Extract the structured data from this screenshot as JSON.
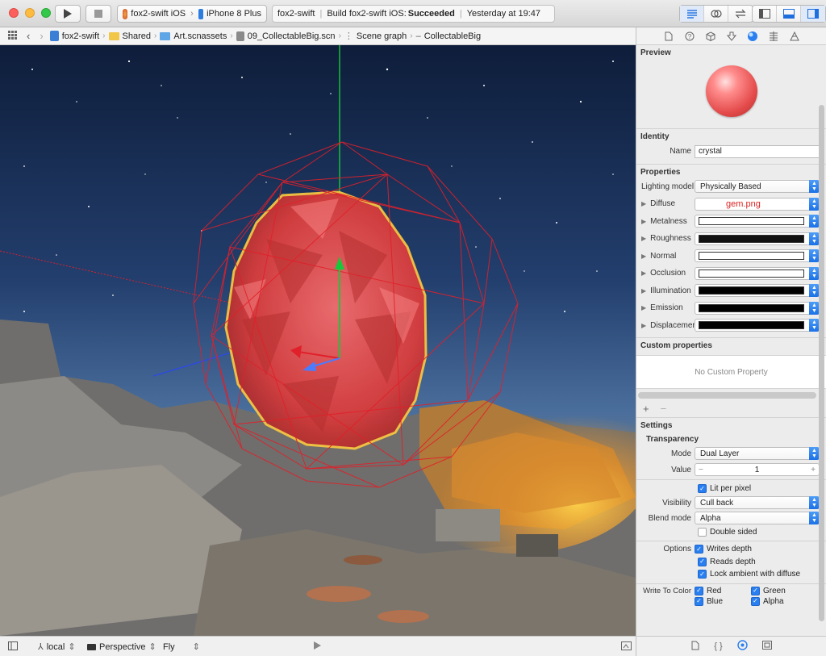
{
  "toolbar": {
    "scheme_app": "fox2-swift iOS",
    "scheme_device": "iPhone 8 Plus",
    "activity_project": "fox2-swift",
    "activity_build": "Build fox2-swift iOS:",
    "activity_status": "Succeeded",
    "activity_time": "Yesterday at 19:47"
  },
  "jumpbar": {
    "items": [
      "fox2-swift",
      "Shared",
      "Art.scnassets",
      "09_CollectableBig.scn",
      "Scene graph",
      "CollectableBig"
    ]
  },
  "bottombar": {
    "space": "local",
    "camera": "Perspective",
    "mode": "Fly"
  },
  "inspector": {
    "preview_title": "Preview",
    "identity_title": "Identity",
    "name_label": "Name",
    "name_value": "crystal",
    "properties_title": "Properties",
    "lighting_label": "Lighting model",
    "lighting_value": "Physically Based",
    "props": [
      {
        "label": "Diffuse",
        "value": "gem.png",
        "color": "#ffffff"
      },
      {
        "label": "Metalness",
        "color": "#ffffff"
      },
      {
        "label": "Roughness",
        "color": "#111111"
      },
      {
        "label": "Normal",
        "color": "#ffffff"
      },
      {
        "label": "Occlusion",
        "color": "#ffffff"
      },
      {
        "label": "Illumination",
        "color": "#000000"
      },
      {
        "label": "Emission",
        "color": "#000000"
      },
      {
        "label": "Displacemen",
        "color": "#000000"
      }
    ],
    "custom_title": "Custom properties",
    "no_custom": "No Custom Property",
    "settings_title": "Settings",
    "transparency_title": "Transparency",
    "mode_label": "Mode",
    "mode_value": "Dual Layer",
    "value_label": "Value",
    "value_value": "1",
    "lit_per_pixel": "Lit per pixel",
    "visibility_label": "Visibility",
    "visibility_value": "Cull back",
    "blend_label": "Blend mode",
    "blend_value": "Alpha",
    "double_sided": "Double sided",
    "options_label": "Options",
    "writes_depth": "Writes depth",
    "reads_depth": "Reads depth",
    "lock_ambient": "Lock ambient with diffuse",
    "write_color_label": "Write To Color",
    "red": "Red",
    "green": "Green",
    "blue": "Blue",
    "alpha": "Alpha"
  },
  "colors": {
    "accent": "#2a7ff0",
    "gem": "#e44b4b",
    "wireframe": "#e0202a"
  }
}
